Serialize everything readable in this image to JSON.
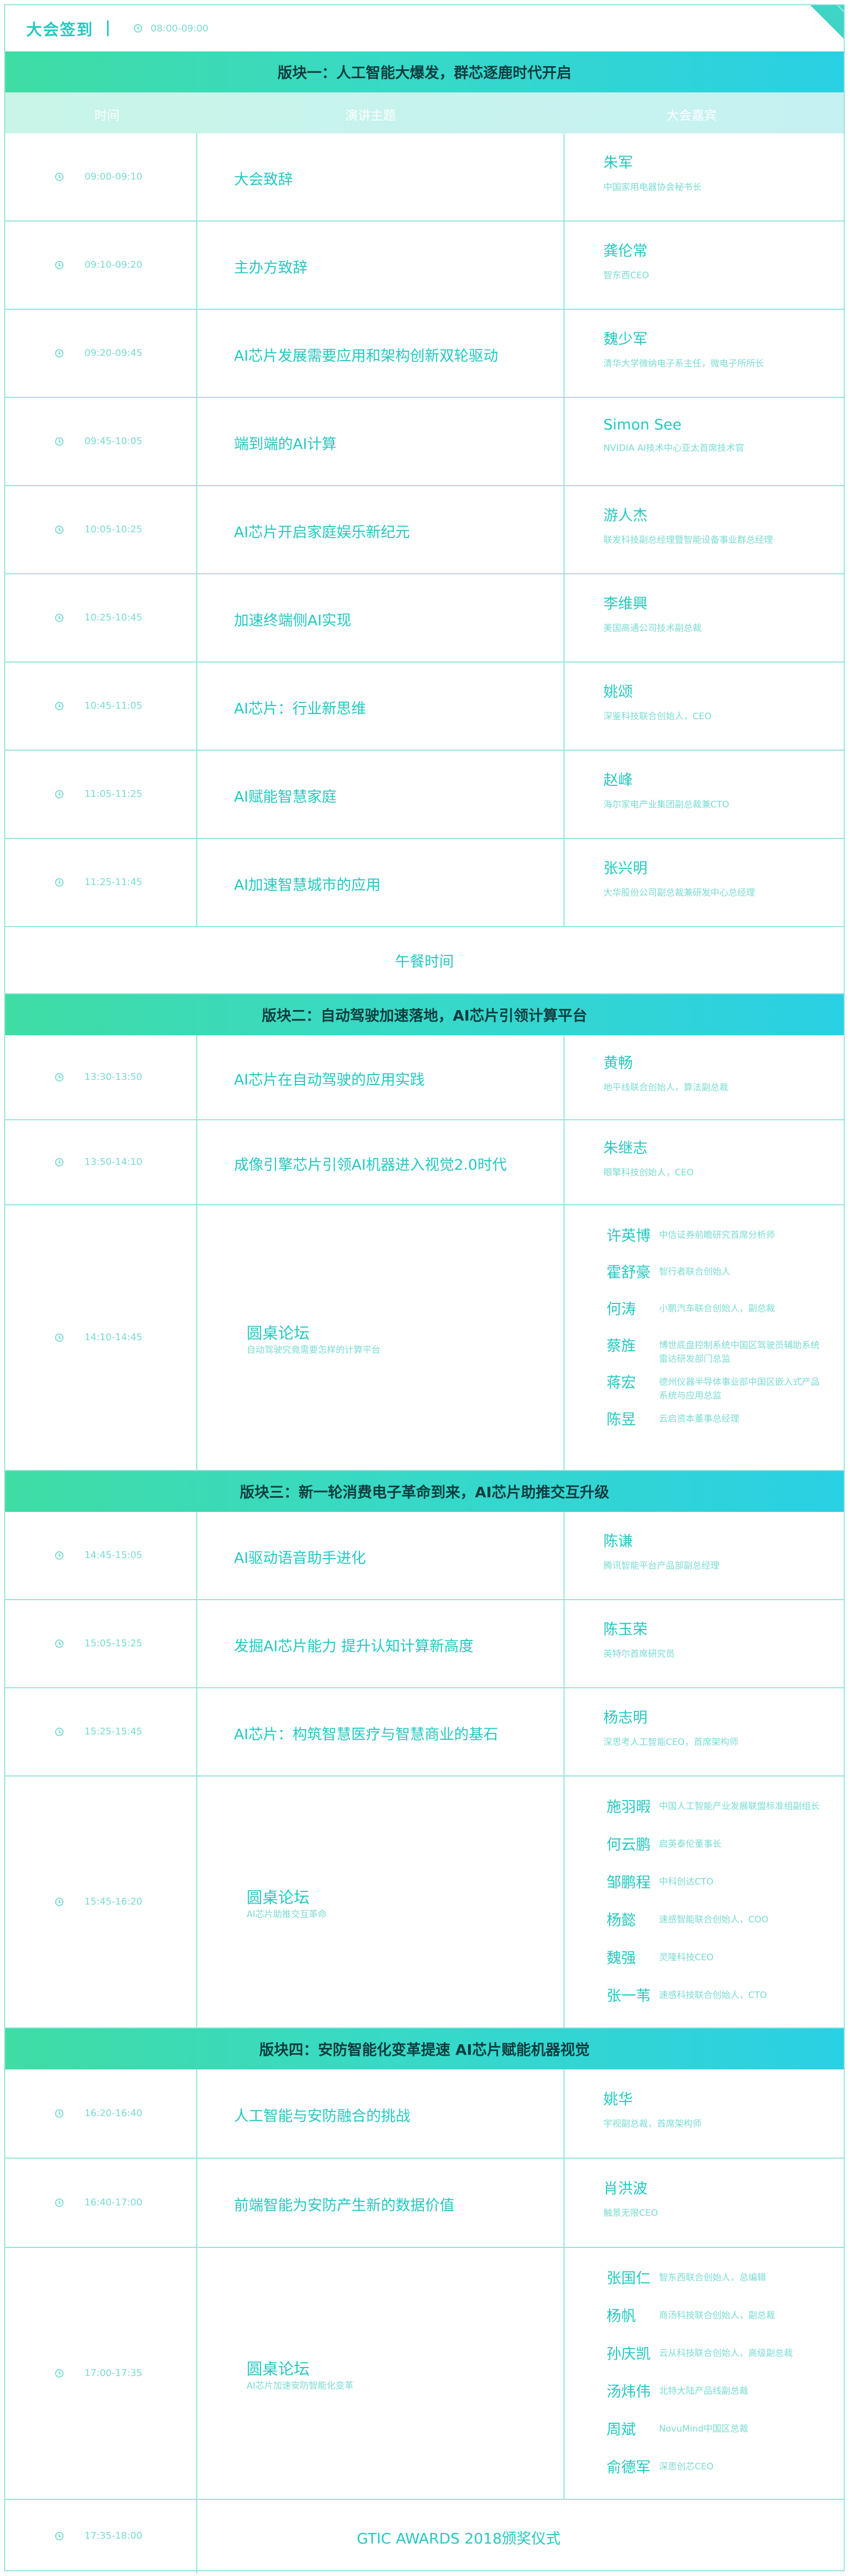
{
  "header": {
    "title": "大会签到",
    "time": "08:00-09:00",
    "accent": "#25c8c0"
  },
  "columns": {
    "time": "时间",
    "topic": "演讲主题",
    "speaker": "大会嘉宾"
  },
  "session1": {
    "title": "版块一：人工智能大爆发，群芯逐鹿时代开启",
    "rows": [
      {
        "time": "09:00-09:10",
        "topic": "大会致辞",
        "name": "朱军",
        "role": "中国家用电器协会秘书长"
      },
      {
        "time": "09:10-09:20",
        "topic": "主办方致辞",
        "name": "龚伦常",
        "role": "智东西CEO"
      },
      {
        "time": "09:20-09:45",
        "topic": "AI芯片发展需要应用和架构创新双轮驱动",
        "name": "魏少军",
        "role": "清华大学微纳电子系主任，微电子所所长"
      },
      {
        "time": "09:45-10:05",
        "topic": "端到端的AI计算",
        "name": "Simon See",
        "role": "NVIDIA AI技术中心亚太首席技术官"
      },
      {
        "time": "10:05-10:25",
        "topic": "AI芯片开启家庭娱乐新纪元",
        "name": "游人杰",
        "role": "联发科技副总经理暨智能设备事业群总经理"
      },
      {
        "time": "10:25-10:45",
        "topic": "加速终端侧AI实现",
        "name": "李维興",
        "role": "美国高通公司技术副总裁"
      },
      {
        "time": "10:45-11:05",
        "topic": "AI芯片：行业新思维",
        "name": "姚颂",
        "role": "深鉴科技联合创始人，CEO"
      },
      {
        "time": "11:05-11:25",
        "topic": "AI赋能智慧家庭",
        "name": "赵峰",
        "role": "海尔家电产业集团副总裁兼CTO"
      },
      {
        "time": "11:25-11:45",
        "topic": "AI加速智慧城市的应用",
        "name": "张兴明",
        "role": "大华股份公司副总裁兼研发中心总经理"
      }
    ],
    "lunch": "午餐时间"
  },
  "session2": {
    "title": "版块二：自动驾驶加速落地，AI芯片引领计算平台",
    "rows": [
      {
        "time": "13:30-13:50",
        "topic": "AI芯片在自动驾驶的应用实践",
        "name": "黄畅",
        "role": "地平线联合创始人，算法副总裁"
      },
      {
        "time": "13:50-14:10",
        "topic": "成像引擎芯片引领AI机器进入视觉2.0时代",
        "name": "朱继志",
        "role": "眼擎科技创始人，CEO"
      }
    ],
    "roundtable": {
      "time": "14:10-14:45",
      "title": "圆桌论坛",
      "subtitle": "自动驾驶究竟需要怎样的计算平台",
      "panelists": [
        {
          "name": "许英博",
          "role": "中信证券前瞻研究首席分析师"
        },
        {
          "name": "霍舒豪",
          "role": "智行者联合创始人"
        },
        {
          "name": "何涛",
          "role": "小鹏汽车联合创始人，副总裁"
        },
        {
          "name": "蔡旌",
          "role": "博世底盘控制系统中国区驾驶员辅助系统雷达研发部门总监"
        },
        {
          "name": "蒋宏",
          "role": "德州仪器半导体事业部中国区嵌入式产品系统与应用总监"
        },
        {
          "name": "陈昱",
          "role": "云启资本董事总经理"
        }
      ]
    }
  },
  "session3": {
    "title": "版块三：新一轮消费电子革命到来，AI芯片助推交互升级",
    "rows": [
      {
        "time": "14:45-15:05",
        "topic": "AI驱动语音助手进化",
        "name": "陈谦",
        "role": "腾讯智能平台产品部副总经理"
      },
      {
        "time": "15:05-15:25",
        "topic": "发掘AI芯片能力 提升认知计算新高度",
        "name": "陈玉荣",
        "role": "英特尔首席研究员"
      },
      {
        "time": "15:25-15:45",
        "topic": "AI芯片：构筑智慧医疗与智慧商业的基石",
        "name": "杨志明",
        "role": "深思考人工智能CEO，首席架构师"
      }
    ],
    "roundtable": {
      "time": "15:45-16:20",
      "title": "圆桌论坛",
      "subtitle": "AI芯片助推交互革命",
      "panelists": [
        {
          "name": "施羽暇",
          "role": "中国人工智能产业发展联盟标准组副组长"
        },
        {
          "name": "何云鹏",
          "role": "启英泰伦董事长"
        },
        {
          "name": "邹鹏程",
          "role": "中科创达CTO"
        },
        {
          "name": "杨懿",
          "role": "速感智能联合创始人，COO"
        },
        {
          "name": "魏强",
          "role": "灵隆科技CEO"
        },
        {
          "name": "张一苇",
          "role": "速感科技联合创始人，CTO"
        }
      ]
    }
  },
  "session4": {
    "title": "版块四：安防智能化变革提速 AI芯片赋能机器视觉",
    "rows": [
      {
        "time": "16:20-16:40",
        "topic": "人工智能与安防融合的挑战",
        "name": "姚华",
        "role": "宇视副总裁，首席架构师"
      },
      {
        "time": "16:40-17:00",
        "topic": "前端智能为安防产生新的数据价值",
        "name": "肖洪波",
        "role": "触景无限CEO"
      }
    ],
    "roundtable": {
      "time": "17:00-17:35",
      "title": "圆桌论坛",
      "subtitle": "AI芯片加速安防智能化变革",
      "panelists": [
        {
          "name": "张国仁",
          "role": "智东西联合创始人，总编辑"
        },
        {
          "name": "杨帆",
          "role": "商汤科技联合创始人，副总裁"
        },
        {
          "name": "孙庆凯",
          "role": "云从科技联合创始人，高级副总裁"
        },
        {
          "name": "汤炜伟",
          "role": "北特大陆产品线副总裁"
        },
        {
          "name": "周斌",
          "role": "NovuMind中国区总裁"
        },
        {
          "name": "俞德军",
          "role": "深思创芯CEO"
        }
      ]
    },
    "award": {
      "time": "17:35-18:00",
      "title": "GTIC AWARDS 2018颁奖仪式"
    }
  }
}
